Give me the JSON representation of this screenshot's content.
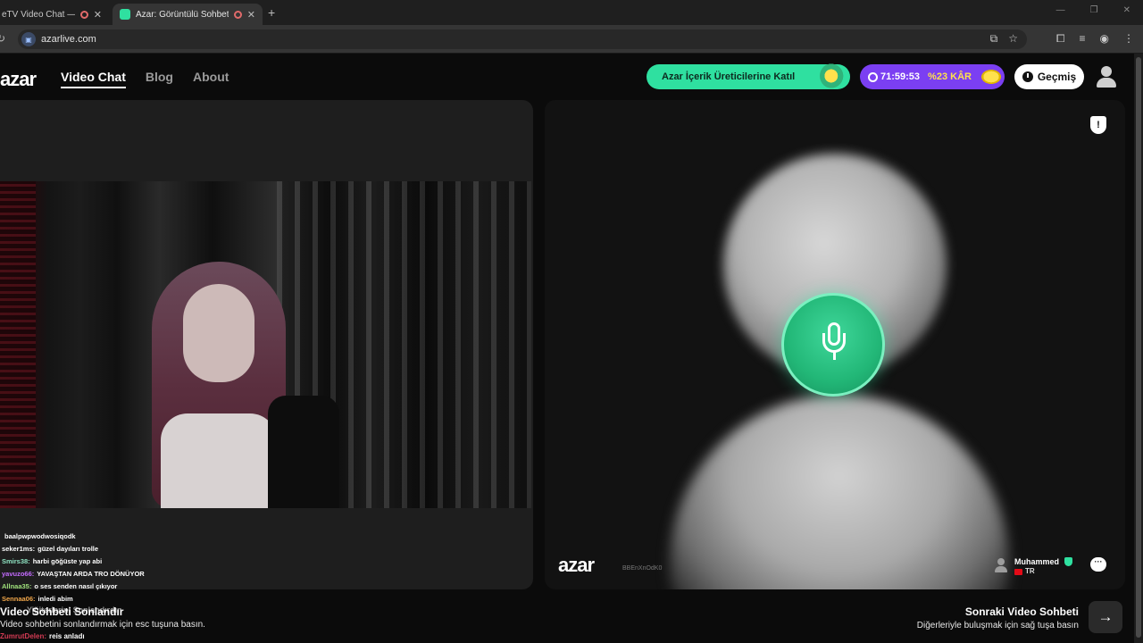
{
  "browser": {
    "tabs": [
      {
        "title": "eTV Video Chat — Ome"
      },
      {
        "title": "Azar: Görüntülü Sohbet & V"
      }
    ],
    "address": "azarlive.com"
  },
  "header": {
    "logo": "azar",
    "nav": [
      {
        "label": "Video Chat",
        "active": true
      },
      {
        "label": "Blog",
        "active": false
      },
      {
        "label": "About",
        "active": false
      }
    ],
    "creator_cta": "Azar İçerik Üreticilerine Katıl",
    "promo": {
      "timer": "71:59:53",
      "discount": "%23 KÂR"
    },
    "history_label": "Geçmiş"
  },
  "stream_chat": [
    {
      "user": "",
      "message": "baalpwpwodwosiqodk",
      "color": "#ffffff"
    },
    {
      "user": "seker1ms:",
      "message": "güzel dayıları trolle",
      "color": "#ffffff"
    },
    {
      "user": "Smirs38:",
      "message": "harbi göğüste yap abi",
      "color": "#8fe3c2"
    },
    {
      "user": "yavuzo66:",
      "message": "YAVAŞTAN ARDA TRO DÖNÜYOR",
      "color": "#c46cff"
    },
    {
      "user": "Allnaa35:",
      "message": "o ses senden nasıl çıkıyor",
      "color": "#9ee07a"
    },
    {
      "user": "Sennaa06:",
      "message": "inledi abim",
      "color": "#f0a64a"
    }
  ],
  "overlay": {
    "title": "Video Sohbeti Sonlandır",
    "title_ghost": "Yiğiterlerini Sonlandırdın",
    "hint": "Video sohbetini sonlandırmak için esc tuşuna basın.",
    "command_user": "ZumrutDelen:",
    "command_msg": "reis anladı"
  },
  "partner": {
    "watermark": "azar",
    "watermark_id": "BBEnXnOdK0",
    "name": "Muhammed",
    "country": "TR"
  },
  "next": {
    "title": "Sonraki Video Sohbeti",
    "hint": "Diğerleriyle buluşmak için sağ tuşa basın"
  }
}
